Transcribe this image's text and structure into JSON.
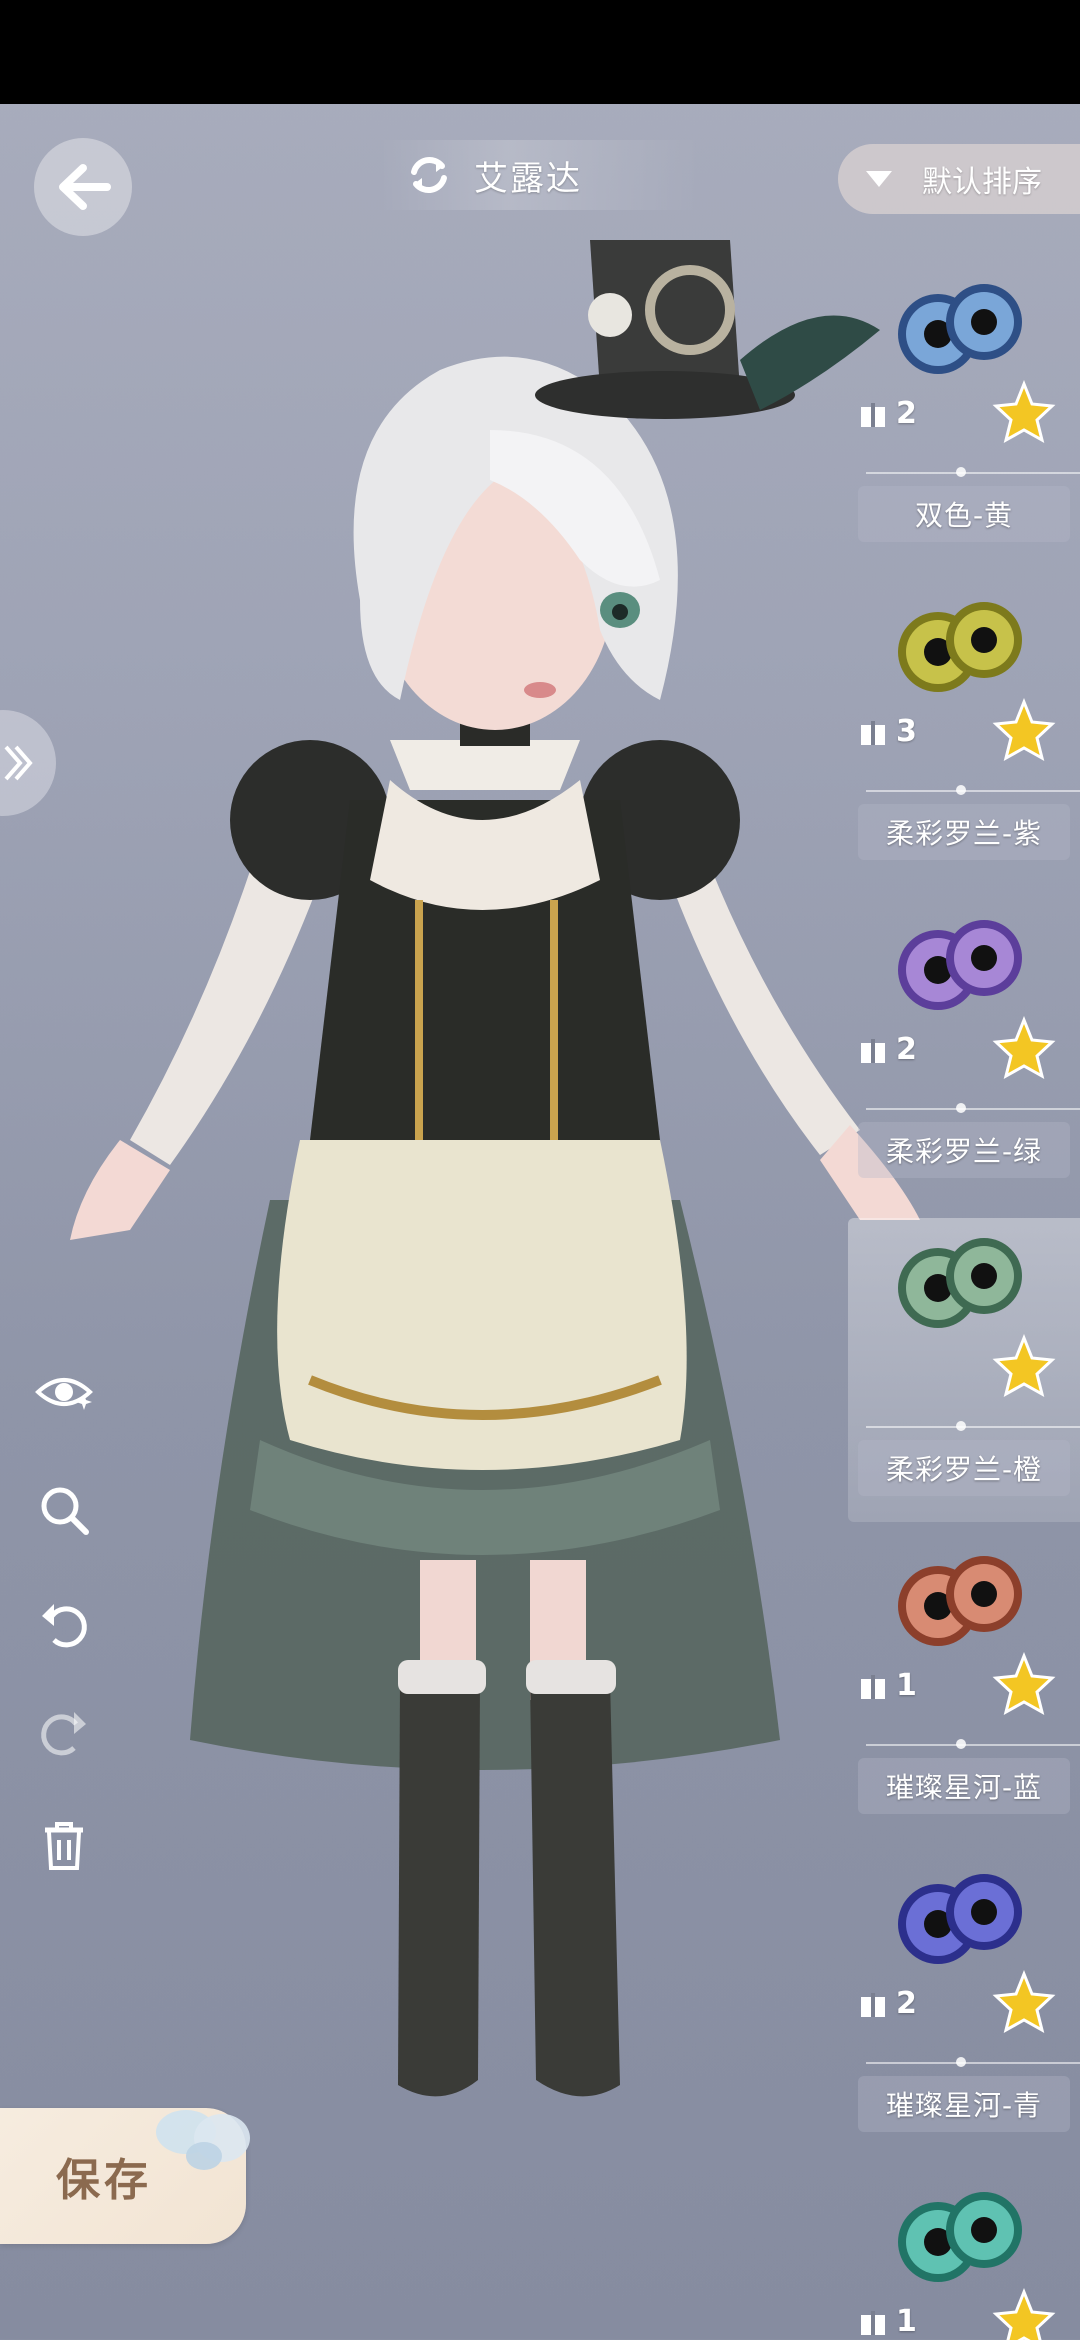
{
  "header": {
    "title": "艾露达",
    "sort_label": "默认排序"
  },
  "save": {
    "label": "保存"
  },
  "tools": [
    "eye-visibility-icon",
    "zoom-icon",
    "undo-icon",
    "redo-icon",
    "trash-icon"
  ],
  "eye_items": [
    {
      "name": "双色-黄",
      "count": "2",
      "iris": "#7aa6d8",
      "ring": "#2e4f86"
    },
    {
      "name": "柔彩罗兰-紫",
      "count": "3",
      "iris": "#c7c24a",
      "ring": "#7d7a1c"
    },
    {
      "name": "柔彩罗兰-绿",
      "count": "2",
      "iris": "#a787d6",
      "ring": "#5c3e9b"
    },
    {
      "name": "柔彩罗兰-橙",
      "count": "",
      "iris": "#8fb79a",
      "ring": "#3f6a52"
    },
    {
      "name": "璀璨星河-蓝",
      "count": "1",
      "iris": "#d88b73",
      "ring": "#8c3f2b"
    },
    {
      "name": "璀璨星河-青",
      "count": "2",
      "iris": "#6b6fd6",
      "ring": "#2c2f8c"
    },
    {
      "name": "",
      "count": "1",
      "iris": "#5fc2b2",
      "ring": "#217466"
    }
  ],
  "colors": {
    "star": "#f3c623",
    "accent": "#ffffff"
  }
}
